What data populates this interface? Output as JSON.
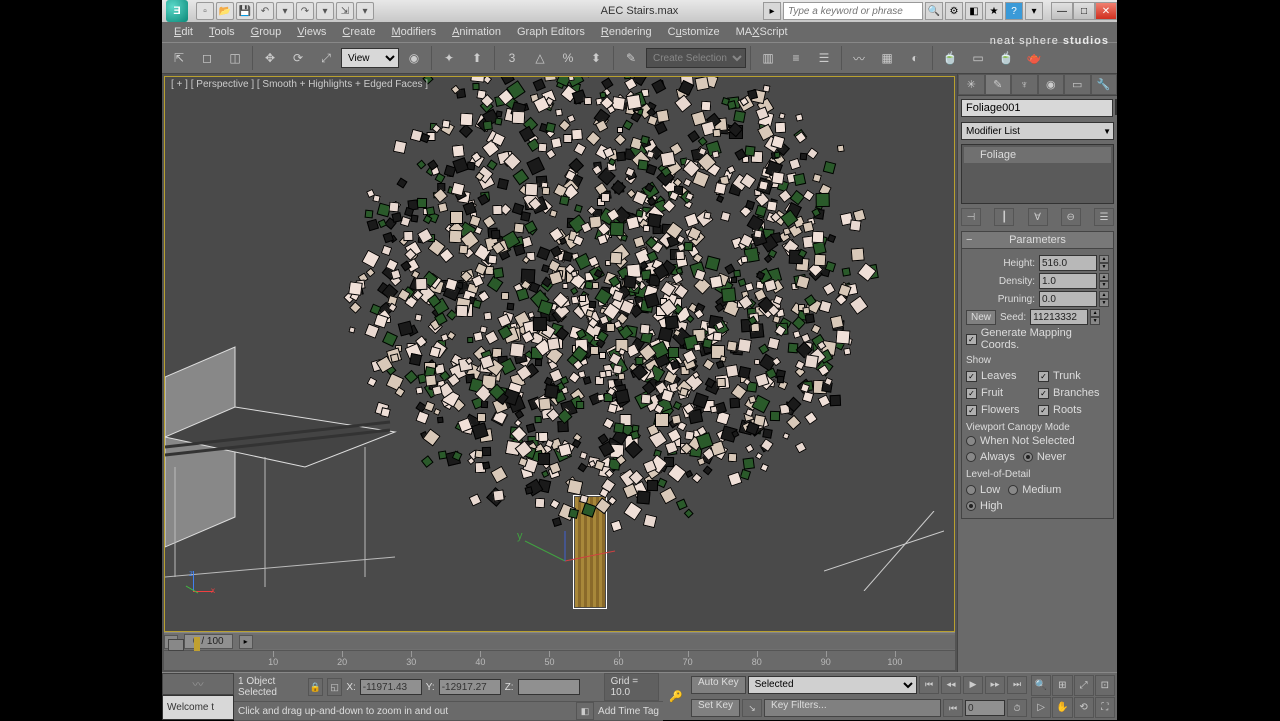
{
  "title": "AEC Stairs.max",
  "search_placeholder": "Type a keyword or phrase",
  "menus": [
    "Edit",
    "Tools",
    "Group",
    "Views",
    "Create",
    "Modifiers",
    "Animation",
    "Graph Editors",
    "Rendering",
    "Customize",
    "MAXScript"
  ],
  "watermark_light": "neat sphere",
  "watermark_bold": " studios",
  "toolbar_combo1": "View",
  "toolbar_combo2": "Create Selection Se",
  "viewport_label": "[ + ] [ Perspective ] [ Smooth + Highlights + Edged Faces ]",
  "timeslider": {
    "pos": "0 / 100",
    "ticks": [
      "10",
      "20",
      "30",
      "40",
      "50",
      "60",
      "70",
      "80",
      "90",
      "100"
    ]
  },
  "cmd": {
    "object_name": "Foliage001",
    "modifier_list": "Modifier List",
    "stack_item": "Foliage",
    "rollout_title": "Parameters",
    "height_label": "Height:",
    "height": "516.0",
    "density_label": "Density:",
    "density": "1.0",
    "pruning_label": "Pruning:",
    "pruning": "0.0",
    "new_btn": "New",
    "seed_label": "Seed:",
    "seed": "11213332",
    "gen_map": "Generate Mapping Coords.",
    "show_label": "Show",
    "leaves": "Leaves",
    "trunk": "Trunk",
    "fruit": "Fruit",
    "branches": "Branches",
    "flowers": "Flowers",
    "roots": "Roots",
    "canopy_label": "Viewport Canopy Mode",
    "when_not": "When Not Selected",
    "always": "Always",
    "never": "Never",
    "lod_label": "Level-of-Detail",
    "low": "Low",
    "medium": "Medium",
    "high": "High"
  },
  "status": {
    "selection": "1 Object Selected",
    "x_label": "X:",
    "x": "-11971.43",
    "y_label": "Y:",
    "y": "-12917.27",
    "z_label": "Z:",
    "z": "",
    "grid": "Grid = 10.0",
    "prompt": "Welcome t",
    "hint": "Click and drag up-and-down to zoom in and out",
    "add_tag": "Add Time Tag",
    "auto_key": "Auto Key",
    "auto_combo": "Selected",
    "set_key": "Set Key",
    "key_filters": "Key Filters...",
    "frame": "0"
  }
}
